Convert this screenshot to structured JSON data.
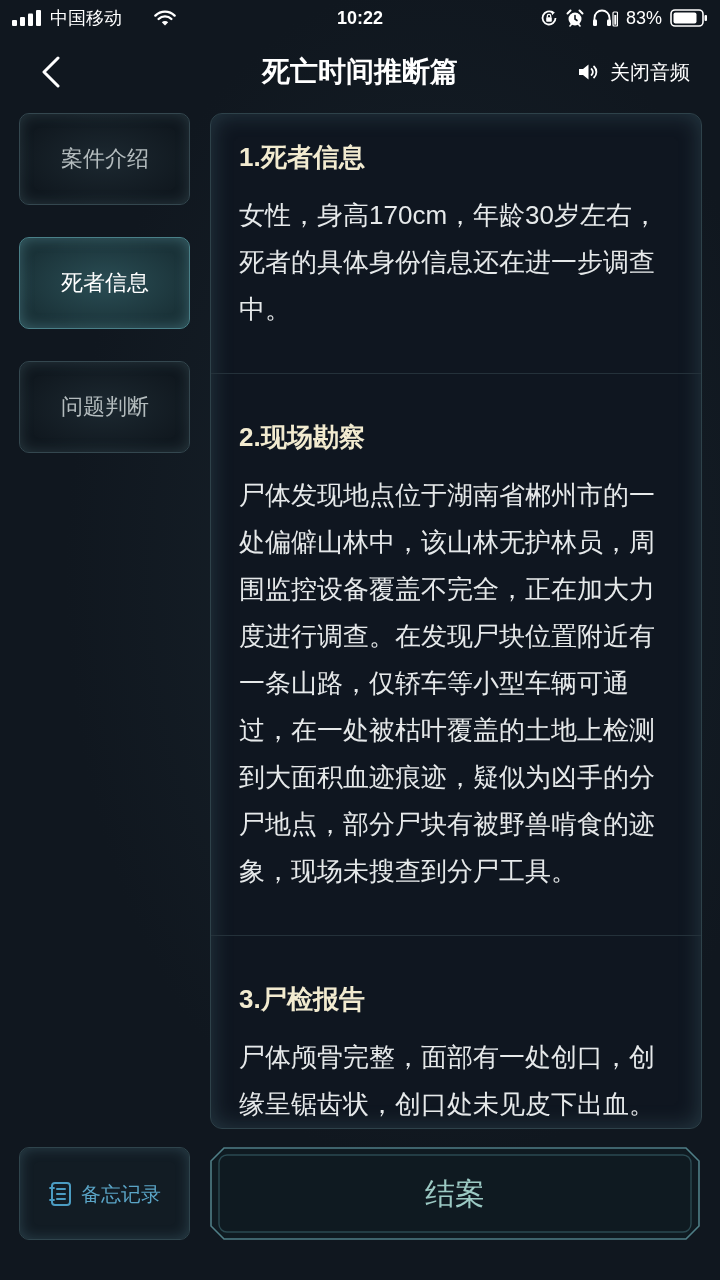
{
  "status_bar": {
    "carrier": "中国移动",
    "time": "10:22",
    "battery": "83%"
  },
  "header": {
    "title": "死亡时间推断篇",
    "audio_button": "关闭音频"
  },
  "sidebar": {
    "tabs": [
      {
        "label": "案件介绍",
        "selected": false
      },
      {
        "label": "死者信息",
        "selected": true
      },
      {
        "label": "问题判断",
        "selected": false
      }
    ],
    "memo_button": "备忘记录"
  },
  "sections": [
    {
      "title": "1.死者信息",
      "text": "女性，身高170cm，年龄30岁左右，死者的具体身份信息还在进一步调查中。"
    },
    {
      "title": "2.现场勘察",
      "text": "尸体发现地点位于湖南省郴州市的一处偏僻山林中，该山林无护林员，周围监控设备覆盖不完全，正在加大力度进行调查。在发现尸块位置附近有一条山路，仅轿车等小型车辆可通过，在一处被枯叶覆盖的土地上检测到大面积血迹痕迹，疑似为凶手的分尸地点，部分尸块有被野兽啃食的迹象，现场未搜查到分尸工具。"
    },
    {
      "title": "3.尸检报告",
      "text": "尸体颅骨完整，面部有一处创口，创缘呈锯齿状，创口处未见皮下出血。"
    }
  ],
  "close_case_button": "结案"
}
